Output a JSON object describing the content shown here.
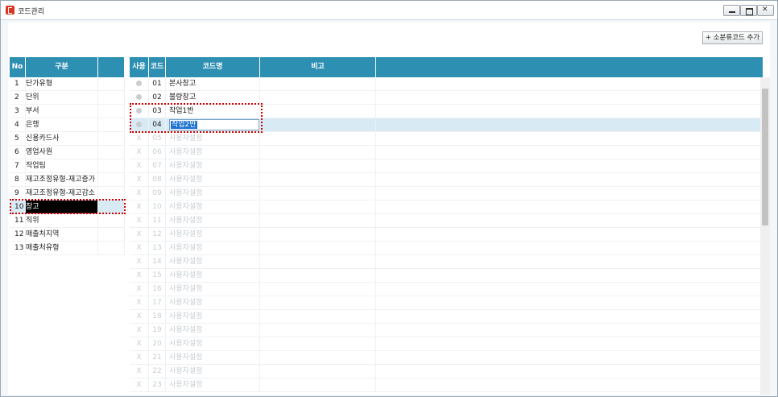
{
  "window": {
    "title": "코드관리"
  },
  "toolbar": {
    "add_label": "+ 소분류코드 추가"
  },
  "left_grid": {
    "headers": [
      "No",
      "구분",
      ""
    ],
    "rows": [
      {
        "no": "1",
        "name": "단가유형"
      },
      {
        "no": "2",
        "name": "단위"
      },
      {
        "no": "3",
        "name": "부서"
      },
      {
        "no": "4",
        "name": "은행"
      },
      {
        "no": "5",
        "name": "신용카드사"
      },
      {
        "no": "6",
        "name": "영업사원"
      },
      {
        "no": "7",
        "name": "작업팀"
      },
      {
        "no": "8",
        "name": "재고조정유형-재고증가"
      },
      {
        "no": "9",
        "name": "재고조정유형-재고감소"
      },
      {
        "no": "10",
        "name": "창고"
      },
      {
        "no": "11",
        "name": "직위"
      },
      {
        "no": "12",
        "name": "매출처지역"
      },
      {
        "no": "13",
        "name": "매출처유형"
      }
    ]
  },
  "right_grid": {
    "headers": [
      "사용",
      "코드",
      "코드명",
      "비고",
      ""
    ],
    "rows": [
      {
        "code": "01",
        "name": "본사창고",
        "active": true
      },
      {
        "code": "02",
        "name": "불량창고",
        "active": true
      },
      {
        "code": "03",
        "name": "작업1반",
        "active": true
      },
      {
        "code": "04",
        "name": "작업2반",
        "active": true
      },
      {
        "code": "05",
        "name": "사용자설정",
        "active": false
      },
      {
        "code": "06",
        "name": "사용자설정",
        "active": false
      },
      {
        "code": "07",
        "name": "사용자설정",
        "active": false
      },
      {
        "code": "08",
        "name": "사용자설정",
        "active": false
      },
      {
        "code": "09",
        "name": "사용자설정",
        "active": false
      },
      {
        "code": "10",
        "name": "사용자설정",
        "active": false
      },
      {
        "code": "11",
        "name": "사용자설정",
        "active": false
      },
      {
        "code": "12",
        "name": "사용자설정",
        "active": false
      },
      {
        "code": "13",
        "name": "사용자설정",
        "active": false
      },
      {
        "code": "14",
        "name": "사용자설정",
        "active": false
      },
      {
        "code": "15",
        "name": "사용자설정",
        "active": false
      },
      {
        "code": "16",
        "name": "사용자설정",
        "active": false
      },
      {
        "code": "17",
        "name": "사용자설정",
        "active": false
      },
      {
        "code": "18",
        "name": "사용자설정",
        "active": false
      },
      {
        "code": "19",
        "name": "사용자설정",
        "active": false
      },
      {
        "code": "20",
        "name": "사용자설정",
        "active": false
      },
      {
        "code": "21",
        "name": "사용자설정",
        "active": false
      },
      {
        "code": "22",
        "name": "사용자설정",
        "active": false
      },
      {
        "code": "23",
        "name": "사용자설정",
        "active": false
      }
    ],
    "inactive_mark": "X"
  },
  "colors": {
    "header": "#2d8fb1",
    "selected_row": "#d8eaf4",
    "highlight": "#d10000"
  }
}
